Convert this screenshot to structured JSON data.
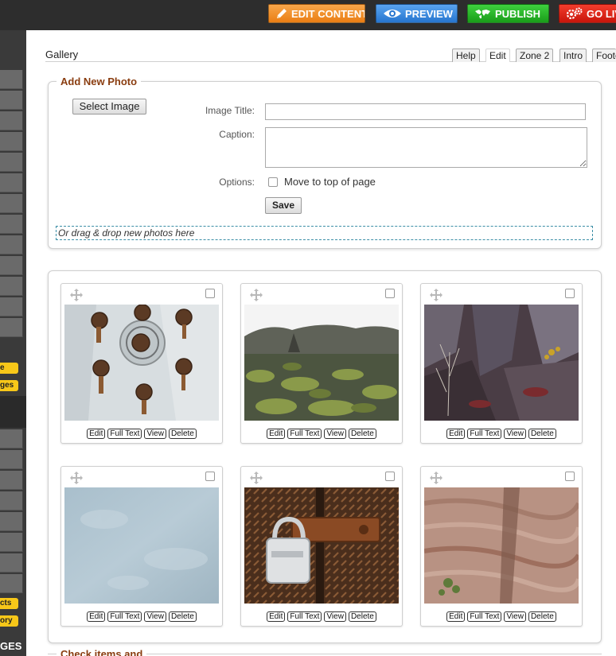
{
  "toolbar": {
    "edit_content": "EDIT CONTENT",
    "preview": "PREVIEW",
    "publish": "PUBLISH",
    "go_live": "GO LIVE"
  },
  "sidebar": {
    "yellow_1": "e",
    "yellow_2": "ges",
    "yellow_3": "cts",
    "yellow_4": "ory",
    "bottom_label": "GES"
  },
  "header": {
    "title": "Gallery",
    "tabs": [
      {
        "label": "Help"
      },
      {
        "label": "Edit"
      },
      {
        "label": "Zone 2"
      },
      {
        "label": "Intro"
      },
      {
        "label": "Footer"
      }
    ]
  },
  "add_photo": {
    "legend": "Add New Photo",
    "select_image": "Select Image",
    "image_title_label": "Image Title:",
    "image_title_value": "",
    "caption_label": "Caption:",
    "caption_value": "",
    "options_label": "Options:",
    "move_to_top": "Move to top of page",
    "save": "Save",
    "dropzone": "Or drag & drop new photos here"
  },
  "gallery": {
    "actions": {
      "edit": "Edit",
      "full_text": "Full Text",
      "view": "View",
      "delete": "Delete"
    },
    "photos": [
      {
        "subject": "rusty bolts on metal plate"
      },
      {
        "subject": "mossy lava field"
      },
      {
        "subject": "rock cliff with dry brush"
      },
      {
        "subject": "blue grey concrete texture"
      },
      {
        "subject": "padlock on rusty hasp"
      },
      {
        "subject": "layered red sandstone"
      }
    ]
  },
  "bottom_section": {
    "legend": "Check items and"
  },
  "icons": {
    "move": "move-arrows-icon",
    "pencil": "pencil-icon",
    "eye": "eye-icon",
    "globe": "globe-icon",
    "gears": "gears-icon"
  },
  "colors": {
    "edit": "#ea7e14",
    "preview": "#2776cf",
    "publish": "#1a9d1a",
    "golive": "#c9160b",
    "legend": "#8a3d10",
    "sidebar_badge": "#f7c719"
  }
}
